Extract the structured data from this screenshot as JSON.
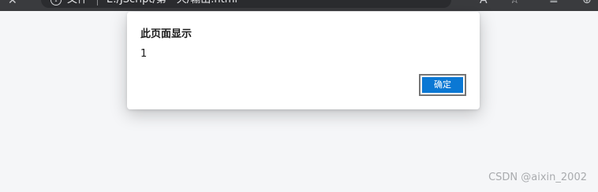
{
  "browser": {
    "protocol_label": "文件",
    "url": "E:/JScript/第一天/输出.html",
    "icons": {
      "back": "close-icon",
      "info": "info-icon",
      "reader": "read-aloud-icon",
      "favorite": "add-favorite-icon",
      "collections": "favorites-list-icon",
      "extensions": "add-tab-icon"
    }
  },
  "dialog": {
    "title": "此页面显示",
    "message": "1",
    "ok_label": "确定"
  },
  "watermark": "CSDN @aixin_2002",
  "colors": {
    "accent": "#0b78d4",
    "page_bg": "#f5f6f8",
    "chrome_bg": "#3a3b3e"
  }
}
